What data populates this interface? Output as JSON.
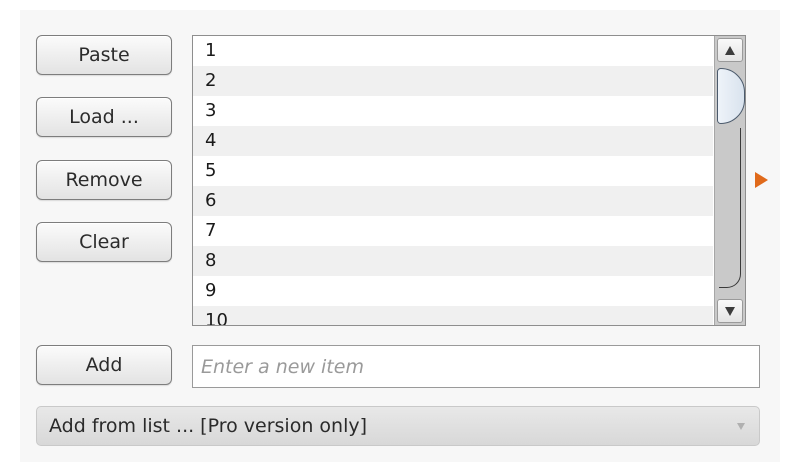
{
  "buttons": {
    "paste": "Paste",
    "load": "Load ...",
    "remove": "Remove",
    "clear": "Clear",
    "add": "Add"
  },
  "list": {
    "items": [
      "1",
      "2",
      "3",
      "4",
      "5",
      "6",
      "7",
      "8",
      "9",
      "10"
    ]
  },
  "new_item": {
    "value": "",
    "placeholder": "Enter a new item"
  },
  "add_from_list": {
    "label": "Add from list ... [Pro version only]"
  },
  "colors": {
    "accent_arrow": "#e06a1b"
  }
}
